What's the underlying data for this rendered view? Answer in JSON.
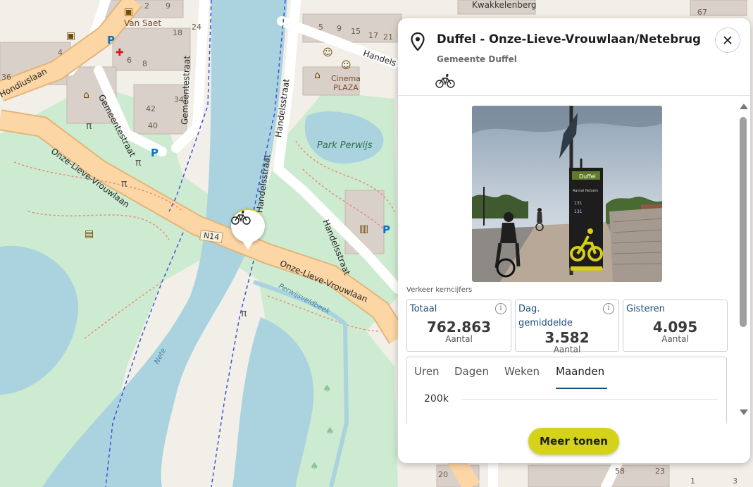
{
  "map": {
    "labels": {
      "van_saet": "Van Saet",
      "hondiuslaan": "Hondiuslaan",
      "gemeentestraat_1": "Gemeentestraat",
      "gemeentestraat_2": "Gemeentestraat",
      "kwakkelenberg": "Kwakkelenberg",
      "handelsstraat_1": "Handelsstraat",
      "handelsstraat_2": "Handelsstraat",
      "handelsstraat_3": "Handelsstraat",
      "handelsstraat_4": "Handelsstraat",
      "handelsstraat_5": "Handels",
      "cinema": "Cinema",
      "plaza": "PLAZA",
      "park_perwijs": "Park Perwijs",
      "onze_lieve_vrouwlaan_1": "Onze-Lieve-Vrouwlaan",
      "onze_lieve_vrouwlaan_2": "Onze-Lieve-Vrouwlaan",
      "n14": "N14",
      "perwijsveldbeek": "Perwijsveldbeek",
      "nete": "Nete"
    },
    "house_numbers": [
      "2",
      "9",
      "5",
      "9",
      "15",
      "17",
      "21",
      "67",
      "18",
      "24",
      "6",
      "8",
      "36",
      "34",
      "42",
      "40",
      "4",
      "3",
      "18",
      "20",
      "58",
      "23",
      "1"
    ]
  },
  "marker": {
    "icon": "bicycle-icon"
  },
  "panel": {
    "title": "Duffel - Onze-Lieve-Vrouwlaan/Netebrug",
    "subtitle": "Gemeente Duffel",
    "mode_icon": "bicycle-icon",
    "photo": {
      "sign_brand": "Duffel",
      "sign_caption": "Aantal fietsers",
      "sign_value_1": "131",
      "sign_value_2": "131"
    },
    "kpi_heading": "Verkeer kerncijfers",
    "kpis": [
      {
        "label": "Totaal",
        "value": "762.863",
        "unit": "Aantal",
        "has_info": true
      },
      {
        "label": "Dag. gemiddelde",
        "value": "3.582",
        "unit": "Aantal",
        "has_info": true
      },
      {
        "label": "Gisteren",
        "value": "4.095",
        "unit": "Aantal",
        "has_info": false
      }
    ],
    "tabs": [
      "Uren",
      "Dagen",
      "Weken",
      "Maanden"
    ],
    "active_tab": "Maanden",
    "chart": {
      "y_tick_label": "200k"
    },
    "more_button": "Meer tonen"
  },
  "colors": {
    "accent": "#d4d31a",
    "kpi_label": "#1d4e7a",
    "park": "#cdebd0",
    "water": "#aad3df",
    "road_major": "#fcd6a4"
  }
}
